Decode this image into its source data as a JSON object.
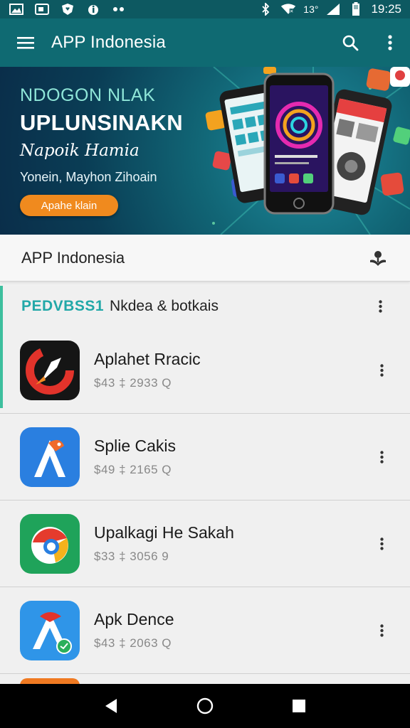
{
  "status_bar": {
    "network": "13°",
    "time": "19:25",
    "icons": [
      "gallery-icon",
      "screen-icon",
      "heart-shield-icon",
      "info-drop-icon",
      "more-dots-icon",
      "bluetooth-icon",
      "wifi-icon",
      "signal-icon",
      "battery-icon"
    ]
  },
  "app_bar": {
    "title": "APP Indonesia",
    "icons": [
      "menu-icon",
      "search-icon",
      "overflow-icon"
    ]
  },
  "banner": {
    "line1": "NDOGON NLAK",
    "line2": "UPLUNSINAKN",
    "line3": "Napoik Hamia",
    "line4": "Yonein, Mayhon Zihoain",
    "cta": "Apahe klain",
    "colors": {
      "accent": "#f08a1e",
      "bg": "#0f6a72"
    }
  },
  "section": {
    "title": "APP Indonesia",
    "icon": "download-hand-icon"
  },
  "list": {
    "kicker": "PEDVBSS1",
    "heading": "Nkdea & botkais",
    "items": [
      {
        "name": "Aplahet Rracic",
        "meta": "$43 ‡ 2933 Q",
        "icon": "rocket-app-icon"
      },
      {
        "name": "Splie Cakis",
        "meta": "$49 ‡ 2165 Q",
        "icon": "a-bird-app-icon"
      },
      {
        "name": "Upalkagi He Sakah",
        "meta": "$33 ‡ 3056 9",
        "icon": "chrome-like-app-icon"
      },
      {
        "name": "Apk Dence",
        "meta": "$43 ‡ 2063 Q",
        "icon": "a-apk-app-icon"
      }
    ]
  },
  "nav": {
    "icons": [
      "back-icon",
      "home-icon",
      "recents-icon"
    ]
  }
}
